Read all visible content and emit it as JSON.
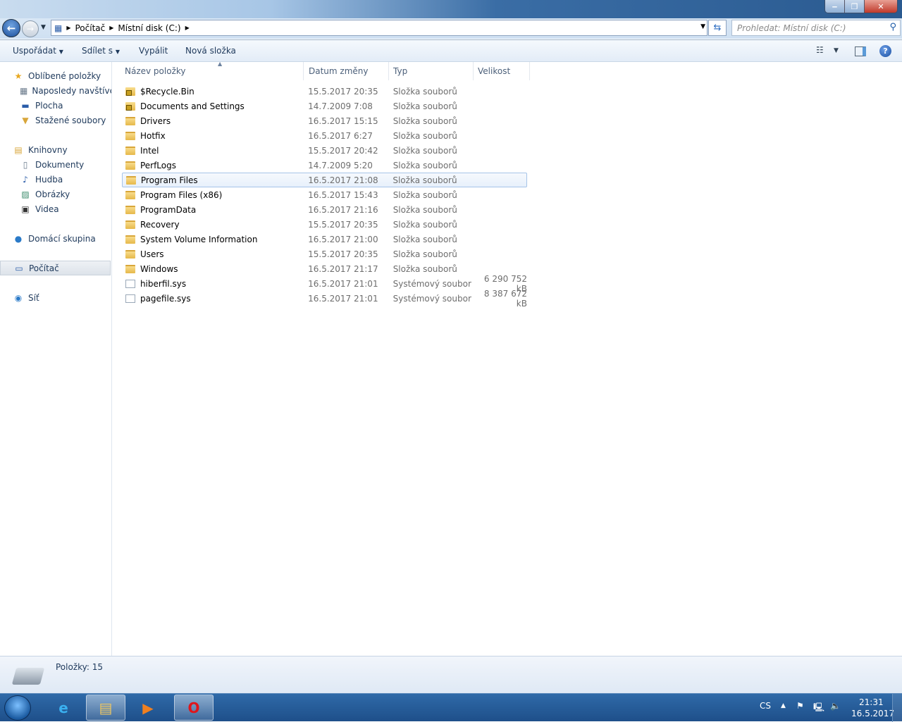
{
  "window": {
    "minimize": "‒",
    "maximize": "❐",
    "close": "✕"
  },
  "address": {
    "crumbs": [
      "Počítač",
      "Místní disk (C:)"
    ],
    "search_placeholder": "Prohledat: Místní disk (C:)"
  },
  "toolbar": {
    "organize": "Uspořádat",
    "share": "Sdílet s",
    "burn": "Vypálit",
    "new_folder": "Nová složka",
    "help": "?"
  },
  "sidebar": {
    "items": [
      {
        "label": "Oblíbené položky",
        "icon": "star-icon",
        "glyph": "★",
        "color": "#e8a820"
      },
      {
        "label": "Naposledy navštívené",
        "icon": "recent-places-icon",
        "glyph": "▦",
        "color": "#6b7b8c"
      },
      {
        "label": "Plocha",
        "icon": "desktop-icon",
        "glyph": "▬",
        "color": "#2a5ca8"
      },
      {
        "label": "Stažené soubory",
        "icon": "downloads-icon",
        "glyph": "▼",
        "color": "#d8a63a"
      },
      {
        "label": "Knihovny",
        "icon": "libraries-icon",
        "glyph": "▤",
        "color": "#d8a63a"
      },
      {
        "label": "Dokumenty",
        "icon": "documents-icon",
        "glyph": "▯",
        "color": "#6b7b8c"
      },
      {
        "label": "Hudba",
        "icon": "music-icon",
        "glyph": "♪",
        "color": "#2a5ca8"
      },
      {
        "label": "Obrázky",
        "icon": "pictures-icon",
        "glyph": "▨",
        "color": "#3a8a6a"
      },
      {
        "label": "Videa",
        "icon": "videos-icon",
        "glyph": "▣",
        "color": "#333"
      },
      {
        "label": "Domácí skupina",
        "icon": "homegroup-icon",
        "glyph": "●",
        "color": "#2a7ac8"
      },
      {
        "label": "Počítač",
        "icon": "computer-icon",
        "glyph": "▭",
        "color": "#2a5ca8"
      },
      {
        "label": "Síť",
        "icon": "network-icon",
        "glyph": "◉",
        "color": "#2a7ac8"
      }
    ]
  },
  "columns": [
    "Název položky",
    "Datum změny",
    "Typ",
    "Velikost"
  ],
  "files": [
    {
      "name": "$Recycle.Bin",
      "date": "15.5.2017 20:35",
      "type": "Složka souborů",
      "size": "",
      "icon": "locked-folder-icon"
    },
    {
      "name": "Documents and Settings",
      "date": "14.7.2009 7:08",
      "type": "Složka souborů",
      "size": "",
      "icon": "locked-folder-icon"
    },
    {
      "name": "Drivers",
      "date": "16.5.2017 15:15",
      "type": "Složka souborů",
      "size": "",
      "icon": "folder-icon"
    },
    {
      "name": "Hotfix",
      "date": "16.5.2017 6:27",
      "type": "Složka souborů",
      "size": "",
      "icon": "folder-icon"
    },
    {
      "name": "Intel",
      "date": "15.5.2017 20:42",
      "type": "Složka souborů",
      "size": "",
      "icon": "folder-icon"
    },
    {
      "name": "PerfLogs",
      "date": "14.7.2009 5:20",
      "type": "Složka souborů",
      "size": "",
      "icon": "folder-icon"
    },
    {
      "name": "Program Files",
      "date": "16.5.2017 21:08",
      "type": "Složka souborů",
      "size": "",
      "icon": "folder-icon",
      "selected": true
    },
    {
      "name": "Program Files (x86)",
      "date": "16.5.2017 15:43",
      "type": "Složka souborů",
      "size": "",
      "icon": "folder-icon"
    },
    {
      "name": "ProgramData",
      "date": "16.5.2017 21:16",
      "type": "Složka souborů",
      "size": "",
      "icon": "folder-icon"
    },
    {
      "name": "Recovery",
      "date": "15.5.2017 20:35",
      "type": "Složka souborů",
      "size": "",
      "icon": "folder-icon"
    },
    {
      "name": "System Volume Information",
      "date": "16.5.2017 21:00",
      "type": "Složka souborů",
      "size": "",
      "icon": "folder-icon"
    },
    {
      "name": "Users",
      "date": "15.5.2017 20:35",
      "type": "Složka souborů",
      "size": "",
      "icon": "folder-icon"
    },
    {
      "name": "Windows",
      "date": "16.5.2017 21:17",
      "type": "Složka souborů",
      "size": "",
      "icon": "folder-icon"
    },
    {
      "name": "hiberfil.sys",
      "date": "16.5.2017 21:01",
      "type": "Systémový soubor",
      "size": "6 290 752 kB",
      "icon": "system-file-icon"
    },
    {
      "name": "pagefile.sys",
      "date": "16.5.2017 21:01",
      "type": "Systémový soubor",
      "size": "8 387 672 kB",
      "icon": "system-file-icon"
    }
  ],
  "status": {
    "count": "Položky: 15"
  },
  "taskbar": {
    "lang": "CS",
    "time": "21:31",
    "date": "16.5.2017",
    "apps": [
      {
        "name": "internet-explorer-icon",
        "glyph": "e",
        "color": "#3ab0f0"
      },
      {
        "name": "file-explorer-icon",
        "glyph": "▤",
        "color": "#f0c860"
      },
      {
        "name": "media-player-icon",
        "glyph": "▶",
        "color": "#f08020"
      },
      {
        "name": "opera-icon",
        "glyph": "O",
        "color": "#e0151b"
      }
    ]
  }
}
